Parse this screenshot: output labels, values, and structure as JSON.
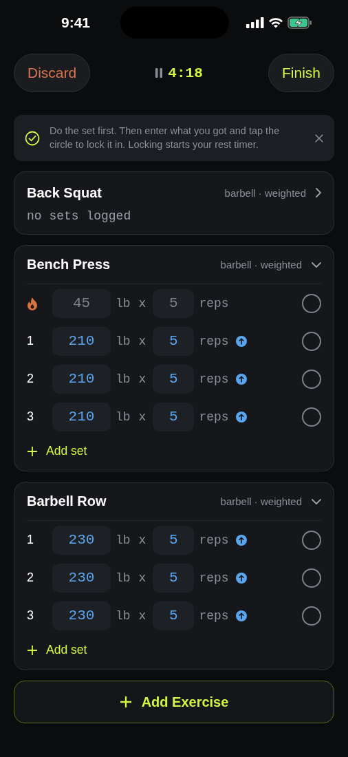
{
  "status_bar": {
    "time": "9:41"
  },
  "header": {
    "discard": "Discard",
    "timer": "4:18",
    "finish": "Finish"
  },
  "tip": {
    "text": "Do the set first. Then enter what you got and tap the circle to lock it in. Locking starts your rest timer."
  },
  "exercises": [
    {
      "name": "Back Squat",
      "meta": "barbell · weighted",
      "expanded": false,
      "empty_text": "no sets logged"
    },
    {
      "name": "Bench Press",
      "meta": "barbell · weighted",
      "expanded": true,
      "add_set": "Add set",
      "sets": [
        {
          "kind": "warmup",
          "weight": "45",
          "unit": "lb",
          "times": "x",
          "reps": "5",
          "reps_unit": "reps",
          "increase": false,
          "done": false
        },
        {
          "kind": "working",
          "number": "1",
          "weight": "210",
          "unit": "lb",
          "times": "x",
          "reps": "5",
          "reps_unit": "reps",
          "increase": true,
          "done": false
        },
        {
          "kind": "working",
          "number": "2",
          "weight": "210",
          "unit": "lb",
          "times": "x",
          "reps": "5",
          "reps_unit": "reps",
          "increase": true,
          "done": false
        },
        {
          "kind": "working",
          "number": "3",
          "weight": "210",
          "unit": "lb",
          "times": "x",
          "reps": "5",
          "reps_unit": "reps",
          "increase": true,
          "done": false
        }
      ]
    },
    {
      "name": "Barbell Row",
      "meta": "barbell · weighted",
      "expanded": true,
      "add_set": "Add set",
      "sets": [
        {
          "kind": "working",
          "number": "1",
          "weight": "230",
          "unit": "lb",
          "times": "x",
          "reps": "5",
          "reps_unit": "reps",
          "increase": true,
          "done": false
        },
        {
          "kind": "working",
          "number": "2",
          "weight": "230",
          "unit": "lb",
          "times": "x",
          "reps": "5",
          "reps_unit": "reps",
          "increase": true,
          "done": false
        },
        {
          "kind": "working",
          "number": "3",
          "weight": "230",
          "unit": "lb",
          "times": "x",
          "reps": "5",
          "reps_unit": "reps",
          "increase": true,
          "done": false
        }
      ]
    }
  ],
  "add_exercise": "Add Exercise"
}
